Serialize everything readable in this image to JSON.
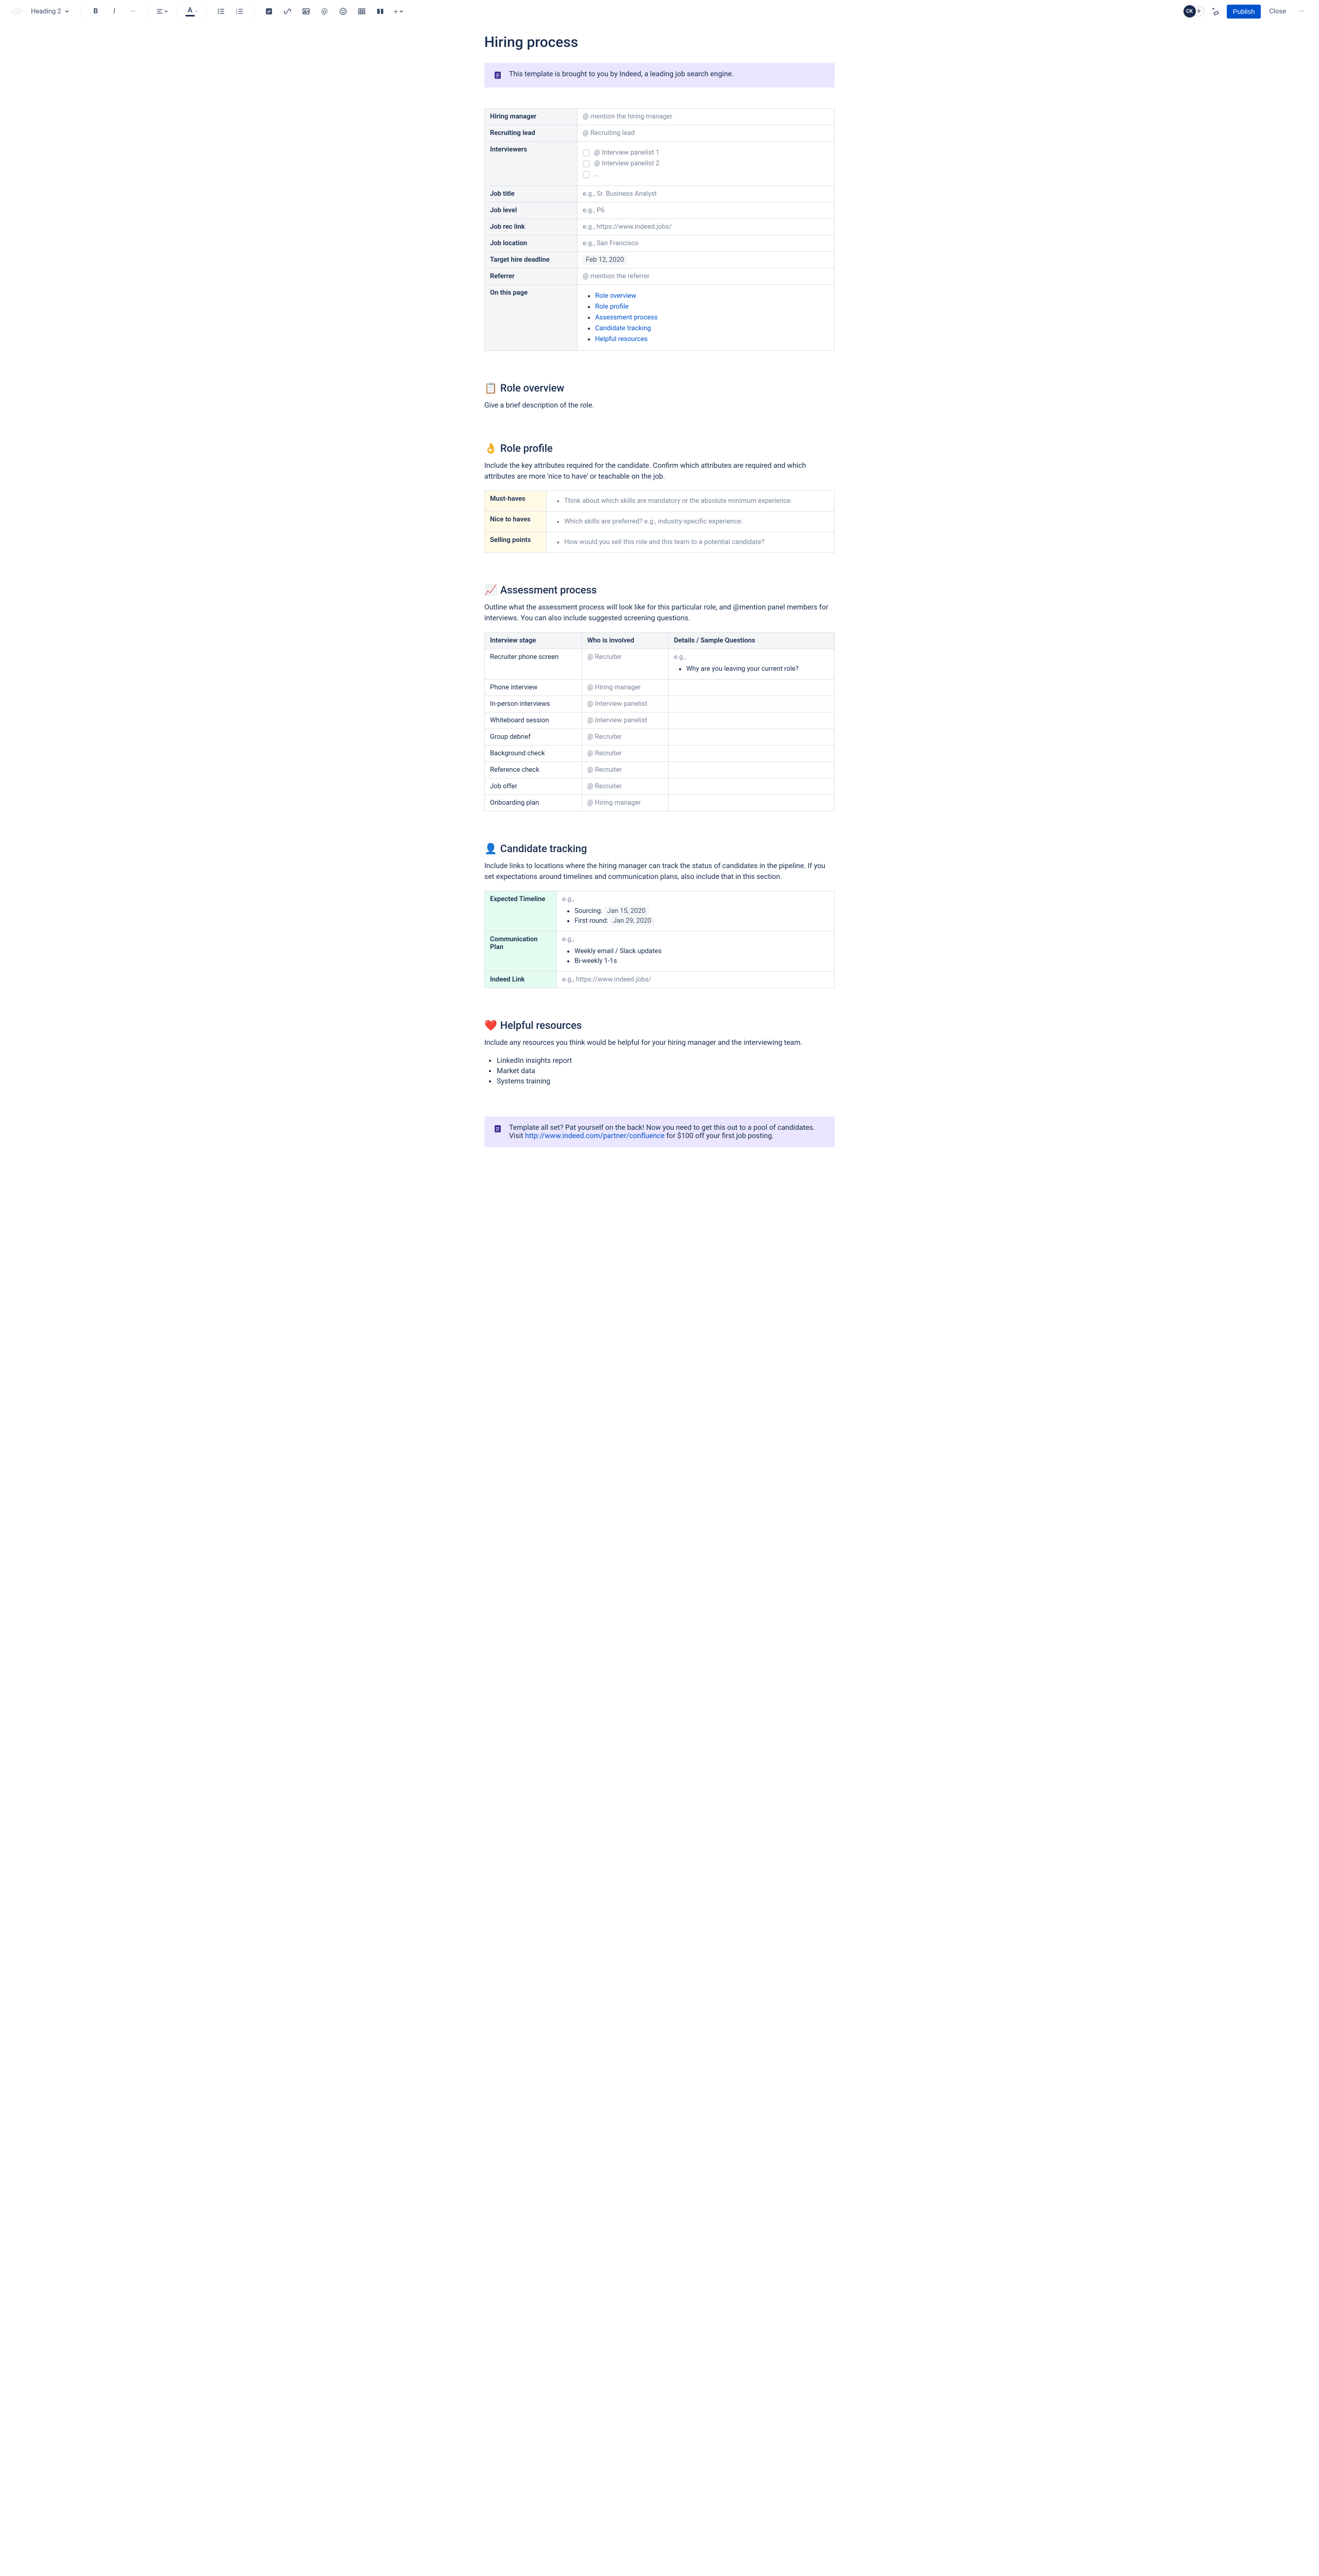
{
  "toolbar": {
    "styleLabel": "Heading 2",
    "publish": "Publish",
    "close": "Close",
    "avatar": "CK"
  },
  "title": "Hiring process",
  "panel1": "This template is brought to you by Indeed, a leading job search engine.",
  "infoTable": {
    "hiringManager": {
      "label": "Hiring manager",
      "placeholder": "@ mention the hiring manager"
    },
    "recruitingLead": {
      "label": "Recruiting lead",
      "placeholder": "@ Recruiting lead"
    },
    "interviewers": {
      "label": "Interviewers",
      "items": [
        "@ Interview panelist 1",
        "@ Interview panelist 2",
        "..."
      ]
    },
    "jobTitle": {
      "label": "Job title",
      "placeholder": "e.g., Sr. Business Analyst"
    },
    "jobLevel": {
      "label": "Job level",
      "placeholder": "e.g., P6"
    },
    "jobRecLink": {
      "label": "Job rec link",
      "placeholder": "e.g., https://www.indeed.jobs/"
    },
    "jobLocation": {
      "label": "Job location",
      "placeholder": "e.g., San Francisco"
    },
    "targetHire": {
      "label": "Target hire deadline",
      "date": "Feb 12, 2020"
    },
    "referrer": {
      "label": "Referrer",
      "placeholder": "@ mention the referrer"
    },
    "onThisPage": {
      "label": "On this page",
      "links": [
        "Role overview",
        "Role profile",
        "Assessment process",
        "Candidate tracking",
        "Helpful resources"
      ]
    }
  },
  "roleOverview": {
    "icon": "📋",
    "title": "Role overview",
    "body": "Give a brief description of the role."
  },
  "roleProfile": {
    "icon": "👌",
    "title": "Role profile",
    "body": "Include the key attributes required for the candidate. Confirm which attributes are required and which attributes are more 'nice to have' or teachable on the job.",
    "rows": [
      {
        "label": "Must-haves",
        "text": "Think about which skills are mandatory or the absolute minimum experience."
      },
      {
        "label": "Nice to haves",
        "text": "Which skills are preferred? e.g., industry-specific experience."
      },
      {
        "label": "Selling points",
        "text": "How would you sell this role and this team to a potential candidate?"
      }
    ]
  },
  "assessment": {
    "icon": "📈",
    "title": "Assessment process",
    "body": "Outline what the assessment process will look like for this particular role, and @mention panel members for interviews. You can also include suggested screening questions.",
    "headers": [
      "Interview stage",
      "Who is involved",
      "Details / Sample Questions"
    ],
    "rows": [
      {
        "stage": "Recruiter phone screen",
        "who": "@ Recruiter",
        "detailsPrefix": "e.g.,",
        "bullet": "Why are you leaving your current role?"
      },
      {
        "stage": "Phone interview",
        "who": "@ Hiring manager"
      },
      {
        "stage": "In-person interviews",
        "who": "@ Interview panelist"
      },
      {
        "stage": "Whiteboard session",
        "who": "@ Interview panelist"
      },
      {
        "stage": "Group debrief",
        "who": "@ Recruiter"
      },
      {
        "stage": "Background check",
        "who": "@ Recruiter"
      },
      {
        "stage": "Reference check",
        "who": "@ Recruiter"
      },
      {
        "stage": "Job offer",
        "who": "@ Recruiter"
      },
      {
        "stage": "Onboarding plan",
        "who": "@ Hiring manager"
      }
    ]
  },
  "tracking": {
    "icon": "👤",
    "title": "Candidate tracking",
    "body": "Include links to locations where the hiring manager can track the status of candidates in the pipeline. If you set expectations around timelines and communication plans, also include that in this section.",
    "timeline": {
      "label": "Expected Timeline",
      "prefix": "e.g.,",
      "sourcing": "Sourcing:",
      "sourcingDate": "Jan 15, 2020",
      "firstRound": "First round:",
      "firstRoundDate": "Jan 29, 2020"
    },
    "commPlan": {
      "label": "Communication Plan",
      "prefix": "e.g.,",
      "items": [
        "Weekly email / Slack updates",
        "Bi-weekly 1-1s"
      ]
    },
    "indeedLink": {
      "label": "Indeed Link",
      "placeholder": "e.g., https://www.indeed.jobs/"
    }
  },
  "resources": {
    "icon": "❤️",
    "title": "Helpful resources",
    "body": "Include any resources you think would be helpful for your hiring manager and the interviewing team.",
    "items": [
      "LinkedIn insights report",
      "Market data",
      "Systems training"
    ]
  },
  "panel2": {
    "text1": "Template all set? Pat yourself on the back! Now you need to get this out to a pool of candidates. Visit ",
    "link": "http://www.indeed.com/partner/confluence",
    "text2": " for $100 off your first job posting."
  }
}
